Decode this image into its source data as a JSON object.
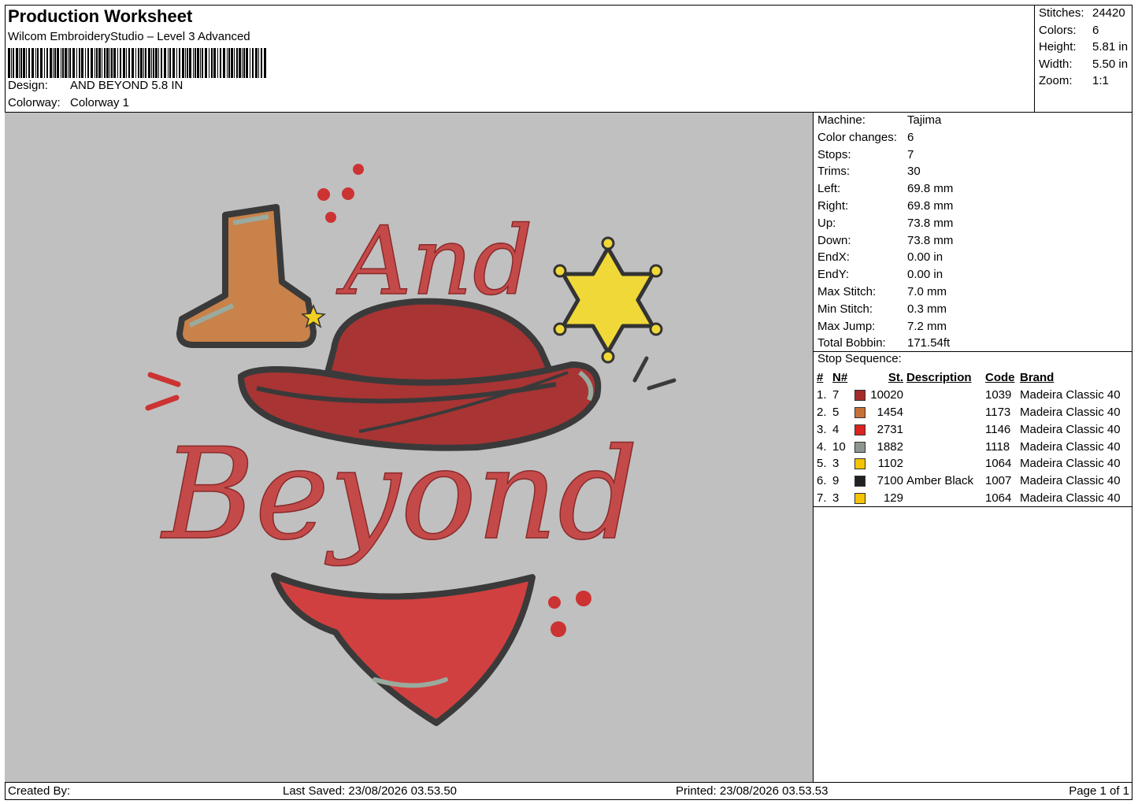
{
  "header": {
    "title": "Production Worksheet",
    "software": "Wilcom EmbroideryStudio – Level 3 Advanced",
    "design_label": "Design:",
    "design_value": "AND BEYOND 5.8 IN",
    "colorway_label": "Colorway:",
    "colorway_value": "Colorway 1"
  },
  "stats": [
    {
      "label": "Stitches:",
      "value": "24420"
    },
    {
      "label": "Colors:",
      "value": "6"
    },
    {
      "label": "Height:",
      "value": "5.81 in"
    },
    {
      "label": "Width:",
      "value": "5.50 in"
    },
    {
      "label": "Zoom:",
      "value": "1:1"
    }
  ],
  "machine_info": [
    {
      "label": "Machine:",
      "value": "Tajima"
    },
    {
      "label": "Color changes:",
      "value": "6"
    },
    {
      "label": "Stops:",
      "value": "7"
    },
    {
      "label": "Trims:",
      "value": "30"
    },
    {
      "label": "Left:",
      "value": "69.8 mm"
    },
    {
      "label": "Right:",
      "value": "69.8 mm"
    },
    {
      "label": "Up:",
      "value": "73.8 mm"
    },
    {
      "label": "Down:",
      "value": "73.8 mm"
    },
    {
      "label": "EndX:",
      "value": "0.00 in"
    },
    {
      "label": "EndY:",
      "value": "0.00 in"
    },
    {
      "label": "Max Stitch:",
      "value": "7.0 mm"
    },
    {
      "label": "Min Stitch:",
      "value": "0.3 mm"
    },
    {
      "label": "Max Jump:",
      "value": "7.2 mm"
    },
    {
      "label": "Total Bobbin:",
      "value": "171.54ft"
    }
  ],
  "stop_sequence": {
    "title": "Stop Sequence:",
    "columns": [
      "#",
      "N#",
      "St.",
      "Description",
      "Code",
      "Brand"
    ],
    "rows": [
      {
        "idx": "1.",
        "n": "7",
        "color": "#a52a2a",
        "st": "10020",
        "desc": "",
        "code": "1039",
        "brand": "Madeira Classic 40"
      },
      {
        "idx": "2.",
        "n": "5",
        "color": "#c87137",
        "st": "1454",
        "desc": "",
        "code": "1173",
        "brand": "Madeira Classic 40"
      },
      {
        "idx": "3.",
        "n": "4",
        "color": "#dd2222",
        "st": "2731",
        "desc": "",
        "code": "1146",
        "brand": "Madeira Classic 40"
      },
      {
        "idx": "4.",
        "n": "10",
        "color": "#8f9690",
        "st": "1882",
        "desc": "",
        "code": "1118",
        "brand": "Madeira Classic 40"
      },
      {
        "idx": "5.",
        "n": "3",
        "color": "#f5c400",
        "st": "1102",
        "desc": "",
        "code": "1064",
        "brand": "Madeira Classic 40"
      },
      {
        "idx": "6.",
        "n": "9",
        "color": "#222222",
        "st": "7100",
        "desc": "Amber Black",
        "code": "1007",
        "brand": "Madeira Classic 40"
      },
      {
        "idx": "7.",
        "n": "3",
        "color": "#f5c400",
        "st": "129",
        "desc": "",
        "code": "1064",
        "brand": "Madeira Classic 40"
      }
    ]
  },
  "design_art": {
    "word1": "And",
    "word2": "Beyond"
  },
  "footer": {
    "created_by": "Created By:",
    "last_saved": "Last Saved: 23/08/2026 03.53.50",
    "printed": "Printed: 23/08/2026 03.53.53",
    "page": "Page 1 of 1"
  }
}
